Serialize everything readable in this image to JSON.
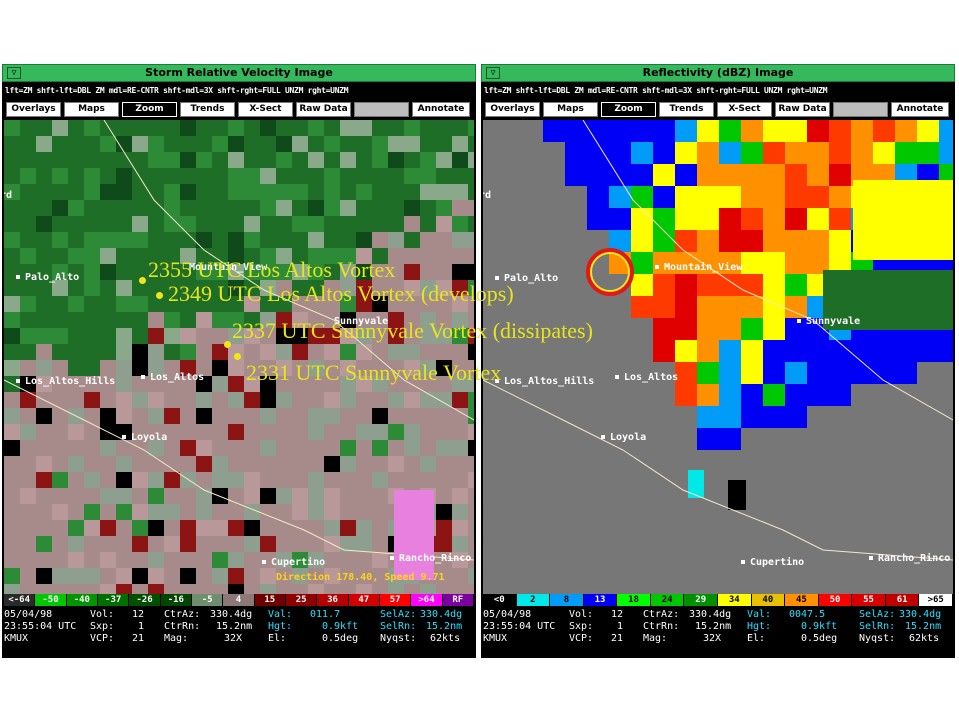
{
  "colors": {
    "title_green": "#36b95c",
    "annotation_yellow": "#e5e51c",
    "status_cyan": "#27e0ff",
    "vortex_circle_red": "#e01818"
  },
  "hints": {
    "text": "lft=ZM  shft-lft=DBL ZM  mdl=RE-CNTR  shft-mdl=3X  shft-rght=FULL UNZM  rght=UNZM"
  },
  "buttons": [
    "Overlays",
    "Maps",
    "Zoom",
    "Trends",
    "X-Sect",
    "Raw Data",
    "",
    "Annotate"
  ],
  "left": {
    "title": "Storm Relative Velocity Image",
    "towns": [
      "Palo_Alto",
      "Mountain_View",
      "Sunnyvale",
      "Los_Altos_Hills",
      "Los_Altos",
      "Loyola",
      "Cupertino",
      "Rancho_Rinco",
      "rd"
    ],
    "annotations": [
      "2355 UTC Los Altos Vortex",
      "2349 UTC Los Altos Vortex (develops)",
      "2337 UTC Sunnyvale Vortex (dissipates)",
      "2331 UTC Sunnyvale Vortex"
    ],
    "direction_text": "Direction 178.40, Speed 9.71",
    "legend": [
      "<-64",
      "-50",
      "-40",
      "-37",
      "-26",
      "-16",
      "-5",
      "4",
      "15",
      "25",
      "36",
      "47",
      "57",
      ">64",
      "RF"
    ],
    "status": {
      "date": "05/04/98",
      "time": "23:55:04 UTC",
      "radar": "KMUX",
      "vol_label": "Vol:",
      "vol": "12",
      "sxp_label": "Sxp:",
      "sxp": "1",
      "vcp_label": "VCP:",
      "vcp": "21",
      "ctraz_label": "CtrAz:",
      "ctraz": "330.4dg",
      "ctrrn_label": "CtrRn:",
      "ctrrn": "15.2nm",
      "mag_label": "Mag:",
      "mag": "32X",
      "val_label": "Val:",
      "val": "011.7",
      "hgt_label": "Hgt:",
      "hgt": "0.9kft",
      "el_label": "El:",
      "el": "0.5deg",
      "selaz_label": "SelAz:",
      "selaz": "330.4dg",
      "selrn_label": "SelRn:",
      "selrn": "15.2nm",
      "nyqst_label": "Nyqst:",
      "nyqst": "62kts"
    }
  },
  "right": {
    "title": "Reflectivity (dBZ) Image",
    "towns": [
      "Palo_Alto",
      "Mountain_View",
      "Sunnyvale",
      "Los_Altos_Hills",
      "Los_Altos",
      "Loyola",
      "Cupertino",
      "Rancho_Rinco",
      "rd"
    ],
    "legend": [
      "<0",
      "2",
      "8",
      "13",
      "18",
      "24",
      "29",
      "34",
      "40",
      "45",
      "50",
      "55",
      "61",
      ">65"
    ],
    "status": {
      "date": "05/04/98",
      "time": "23:55:04 UTC",
      "radar": "KMUX",
      "vol_label": "Vol:",
      "vol": "12",
      "sxp_label": "Sxp:",
      "sxp": "1",
      "vcp_label": "VCP:",
      "vcp": "21",
      "ctraz_label": "CtrAz:",
      "ctraz": "330.4dg",
      "ctrrn_label": "CtrRn:",
      "ctrrn": "15.2nm",
      "mag_label": "Mag:",
      "mag": "32X",
      "val_label": "Val:",
      "val": "0047.5",
      "hgt_label": "Hgt:",
      "hgt": "0.9kft",
      "el_label": "El:",
      "el": "0.5deg",
      "selaz_label": "SelAz:",
      "selaz": "330.4dg",
      "selrn_label": "SelRn:",
      "selrn": "15.2nm",
      "nyqst_label": "Nyqst:",
      "nyqst": "62kts"
    }
  }
}
